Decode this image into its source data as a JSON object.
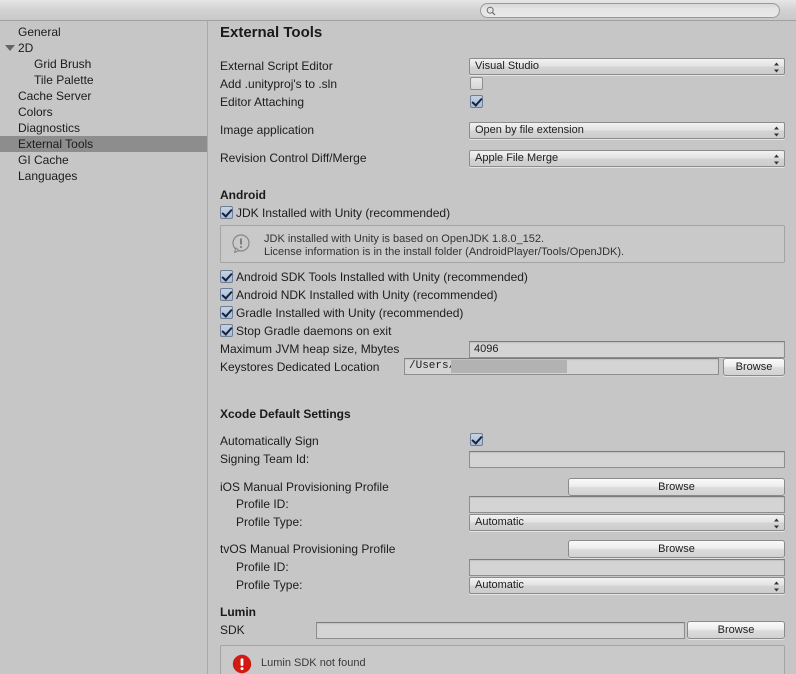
{
  "window": {
    "title": "External Tools"
  },
  "search": {
    "value": "",
    "placeholder": "",
    "icon": "search-icon"
  },
  "sidebar": {
    "items": [
      {
        "label": "General",
        "level": 0,
        "selected": false,
        "expandable": false
      },
      {
        "label": "2D",
        "level": 0,
        "selected": false,
        "expandable": true
      },
      {
        "label": "Grid Brush",
        "level": 1,
        "selected": false,
        "expandable": false
      },
      {
        "label": "Tile Palette",
        "level": 1,
        "selected": false,
        "expandable": false
      },
      {
        "label": "Cache Server",
        "level": 0,
        "selected": false,
        "expandable": false
      },
      {
        "label": "Colors",
        "level": 0,
        "selected": false,
        "expandable": false
      },
      {
        "label": "Diagnostics",
        "level": 0,
        "selected": false,
        "expandable": false
      },
      {
        "label": "External Tools",
        "level": 0,
        "selected": true,
        "expandable": false
      },
      {
        "label": "GI Cache",
        "level": 0,
        "selected": false,
        "expandable": false
      },
      {
        "label": "Languages",
        "level": 0,
        "selected": false,
        "expandable": false
      }
    ]
  },
  "editor_section": {
    "script_editor": {
      "label": "External Script Editor",
      "value": "Visual Studio"
    },
    "unityproj": {
      "label": "Add .unityproj's to .sln",
      "checked": false
    },
    "editor_attaching": {
      "label": "Editor Attaching",
      "checked": true
    },
    "image_application": {
      "label": "Image application",
      "value": "Open by file extension"
    },
    "revision_control": {
      "label": "Revision Control Diff/Merge",
      "value": "Apple File Merge"
    }
  },
  "android": {
    "heading": "Android",
    "jdk": {
      "label": "JDK Installed with Unity (recommended)",
      "checked": true
    },
    "jdk_info": {
      "icon": "info-icon",
      "line1": "JDK installed with Unity is based on OpenJDK 1.8.0_152.",
      "line2": "License information is in the install folder (AndroidPlayer/Tools/OpenJDK)."
    },
    "sdk_tools": {
      "label": "Android SDK Tools Installed with Unity (recommended)",
      "checked": true
    },
    "ndk": {
      "label": "Android NDK Installed with Unity (recommended)",
      "checked": true
    },
    "gradle": {
      "label": "Gradle Installed with Unity (recommended)",
      "checked": true
    },
    "stop_gradle": {
      "label": "Stop Gradle daemons on exit",
      "checked": true
    },
    "jvm_heap": {
      "label": "Maximum JVM heap size, Mbytes",
      "value": "4096"
    },
    "keystores": {
      "label": "Keystores Dedicated Location",
      "value": "/Users/",
      "browse_label": "Browse"
    }
  },
  "xcode": {
    "heading": "Xcode Default Settings",
    "auto_sign": {
      "label": "Automatically Sign",
      "checked": true
    },
    "signing_team": {
      "label": "Signing Team Id:",
      "value": ""
    },
    "ios_profile": {
      "label": "iOS Manual Provisioning Profile",
      "browse_label": "Browse",
      "profile_id_label": "Profile ID:",
      "profile_id_value": "",
      "profile_type_label": "Profile Type:",
      "profile_type_value": "Automatic"
    },
    "tvos_profile": {
      "label": "tvOS Manual Provisioning Profile",
      "browse_label": "Browse",
      "profile_id_label": "Profile ID:",
      "profile_id_value": "",
      "profile_type_label": "Profile Type:",
      "profile_type_value": "Automatic"
    }
  },
  "lumin": {
    "heading": "Lumin",
    "sdk": {
      "label": "SDK",
      "value": "",
      "browse_label": "Browse"
    },
    "error": {
      "icon": "error-icon",
      "message": "Lumin SDK not found"
    }
  },
  "colors": {
    "window_bg": "#c6c6c6",
    "selection": "#8d8d8d",
    "checkbox_on": "#a9bcd6",
    "error_red": "#d11a12",
    "text": "#1c1c1c"
  }
}
